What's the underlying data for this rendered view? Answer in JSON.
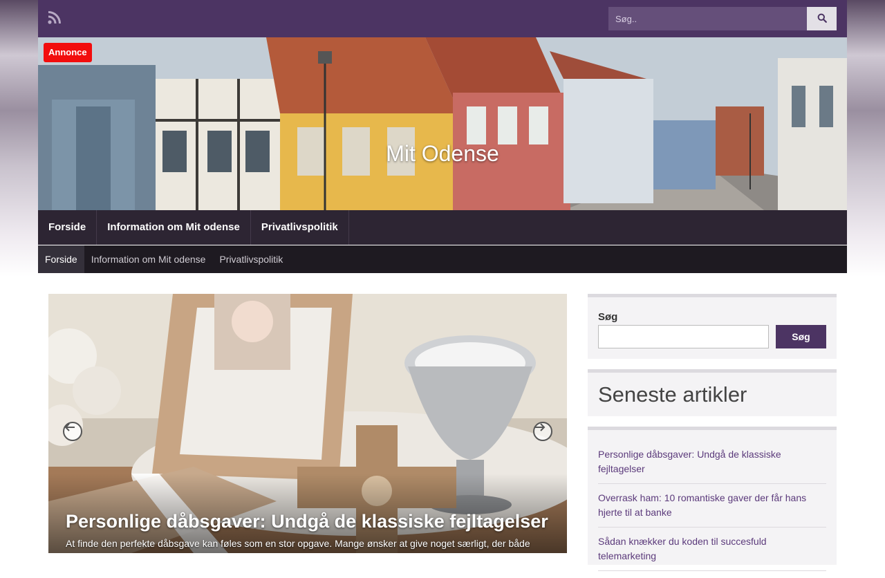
{
  "topbar": {
    "search_placeholder": "Søg..",
    "icons": {
      "rss": "rss-icon",
      "search": "search-icon"
    }
  },
  "header": {
    "badge": "Annonce",
    "site_title": "Mit Odense"
  },
  "nav_primary": [
    {
      "label": "Forside"
    },
    {
      "label": "Information om Mit odense"
    },
    {
      "label": "Privatlivspolitik"
    }
  ],
  "nav_secondary": [
    {
      "label": "Forside",
      "active": true
    },
    {
      "label": "Information om Mit odense",
      "active": false
    },
    {
      "label": "Privatlivspolitik",
      "active": false
    }
  ],
  "slider": {
    "title": "Personlige dåbsgaver: Undgå de klassiske fejltagelser",
    "excerpt": "At finde den perfekte dåbsgave kan føles som en stor opgave. Mange ønsker at give noget særligt, der både har betydning for barnet og familien"
  },
  "sidebar": {
    "search": {
      "label": "Søg",
      "button": "Søg"
    },
    "latest": {
      "heading": "Seneste artikler",
      "items": [
        {
          "label": "Personlige dåbsgaver: Undgå de klassiske fejltagelser"
        },
        {
          "label": "Overrask ham: 10 romantiske gaver der får hans hjerte til at banke"
        },
        {
          "label": "Sådan knækker du koden til succesfuld telemarketing"
        }
      ]
    }
  },
  "colors": {
    "brand": "#4c3463",
    "badge": "#f20d0d",
    "nav_dark": "#2d2533",
    "link": "#5b3a7b"
  }
}
